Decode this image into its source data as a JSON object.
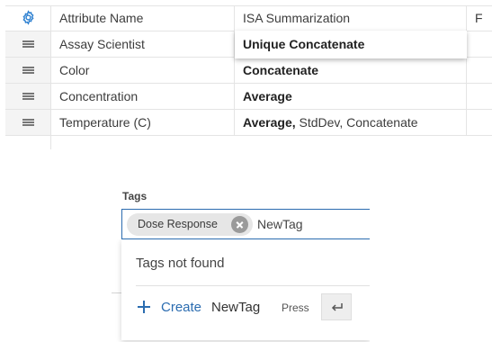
{
  "table": {
    "headers": {
      "settings_icon": "gear-icon",
      "attribute_name": "Attribute Name",
      "isa_summarization": "ISA Summarization",
      "extra": "F"
    },
    "rows": [
      {
        "attribute": "Assay Scientist",
        "summary_bold": "Unique Concatenate",
        "summary_rest": ""
      },
      {
        "attribute": "Color",
        "summary_bold": "Concatenate",
        "summary_rest": ""
      },
      {
        "attribute": "Concentration",
        "summary_bold": "Average",
        "summary_rest": ""
      },
      {
        "attribute": "Temperature (C)",
        "summary_bold": "Average,",
        "summary_rest": " StdDev, Concatenate"
      }
    ],
    "drag_icon": "drag-handle-icon"
  },
  "tags": {
    "label": "Tags",
    "chips": [
      {
        "label": "Dose Response",
        "remove_icon": "close-circle-icon"
      }
    ],
    "input_value": "NewTag",
    "dropdown": {
      "empty_message": "Tags not found",
      "create_icon": "plus-icon",
      "create_label": "Create",
      "create_value": "NewTag",
      "press_hint": "Press",
      "enter_icon": "enter-key-icon"
    }
  },
  "colors": {
    "accent": "#2b6cb0",
    "grid_line": "#e4e4e4",
    "chip_bg": "#e6e6e6"
  }
}
